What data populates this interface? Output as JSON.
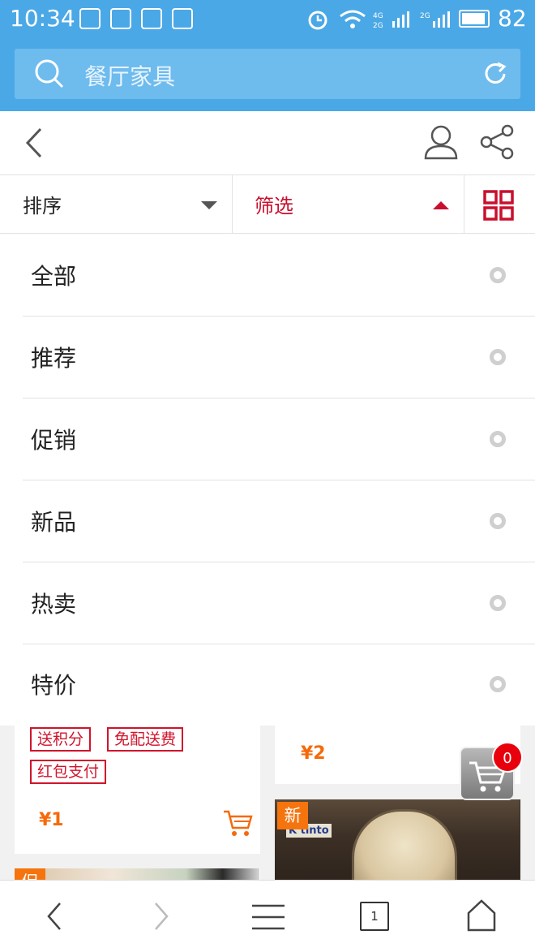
{
  "status_bar": {
    "time": "10:34",
    "battery": "82"
  },
  "search": {
    "text": "餐厅家具"
  },
  "sort_bar": {
    "sort_label": "排序",
    "filter_label": "筛选"
  },
  "filter_options": [
    "全部",
    "推荐",
    "促销",
    "新品",
    "热卖",
    "特价"
  ],
  "products": {
    "left": {
      "tags": [
        "送积分",
        "免配送费",
        "红包支付"
      ],
      "price": "¥1",
      "next_badge": "促"
    },
    "right": {
      "price": "¥2",
      "badge": "新",
      "brand": "K tinto"
    }
  },
  "cart": {
    "count": "0"
  },
  "bottom_bar": {
    "tabs_count": "1"
  },
  "colors": {
    "header_blue": "#4ba8e6",
    "accent_red": "#c8102e",
    "price_orange": "#f56a0a"
  }
}
